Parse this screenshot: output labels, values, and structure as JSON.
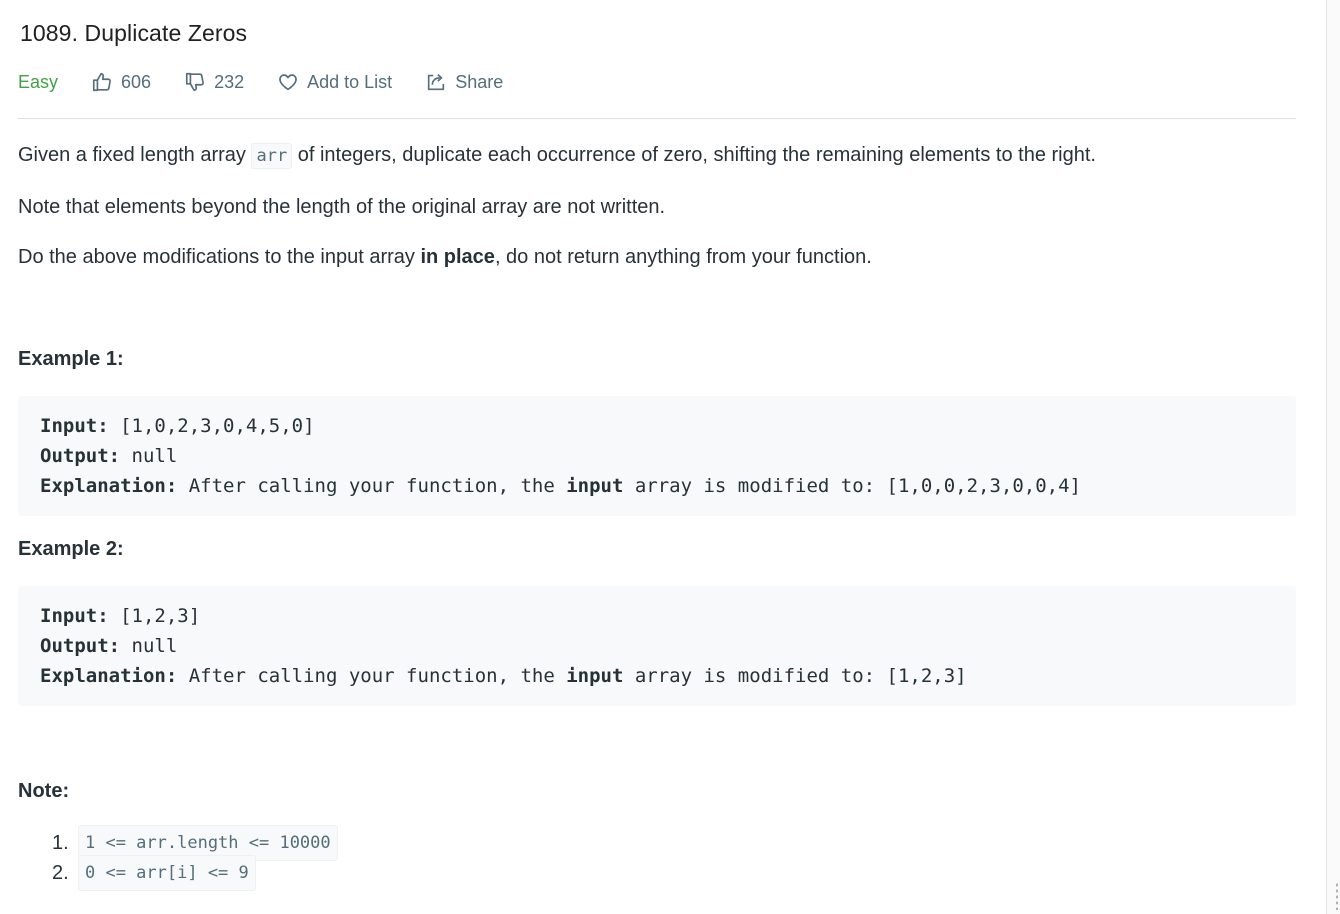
{
  "problem": {
    "title": "1089. Duplicate Zeros",
    "difficulty": "Easy",
    "likes": "606",
    "dislikes": "232",
    "add_to_list": "Add to List",
    "share": "Share"
  },
  "description": {
    "p1_before": "Given a fixed length array ",
    "p1_code": "arr",
    "p1_after": " of integers, duplicate each occurrence of zero, shifting the remaining elements to the right.",
    "p2": "Note that elements beyond the length of the original array are not written.",
    "p3_before": "Do the above modifications to the input array ",
    "p3_bold": "in place",
    "p3_after": ", do not return anything from your function."
  },
  "examples": [
    {
      "heading": "Example 1:",
      "input_label": "Input:",
      "input_value": " [1,0,2,3,0,4,5,0]",
      "output_label": "Output:",
      "output_value": " null",
      "explanation_label": "Explanation:",
      "explanation_before": " After calling your function, the ",
      "explanation_bold": "input",
      "explanation_after": " array is modified to: [1,0,0,2,3,0,0,4]"
    },
    {
      "heading": "Example 2:",
      "input_label": "Input:",
      "input_value": " [1,2,3]",
      "output_label": "Output:",
      "output_value": " null",
      "explanation_label": "Explanation:",
      "explanation_before": " After calling your function, the ",
      "explanation_bold": "input",
      "explanation_after": " array is modified to: [1,2,3]"
    }
  ],
  "note": {
    "heading": "Note:",
    "items": [
      {
        "num": "1.",
        "code": "1 <= arr.length <= 10000"
      },
      {
        "num": "2.",
        "code": "0 <= arr[i] <= 9"
      }
    ]
  },
  "colors": {
    "easy": "#43a047",
    "meta_text": "#546e7a",
    "code_bg": "#f7f9fa"
  }
}
